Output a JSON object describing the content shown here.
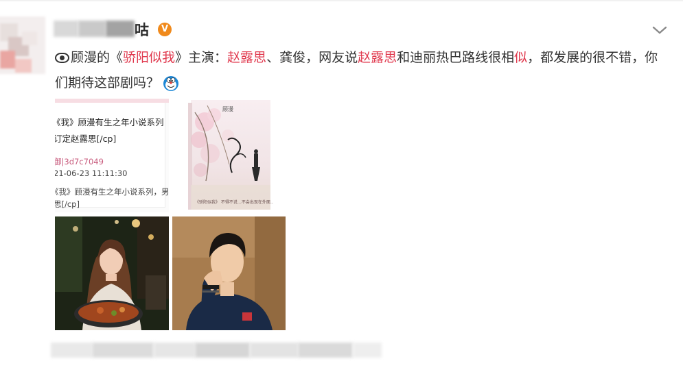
{
  "post": {
    "author_suffix": "咕",
    "verified_badge": "V",
    "menu_icon": "chevron-down-icon",
    "text": {
      "emoji_leading": "eye-emoji",
      "p1": "顾漫的《",
      "book_title": "骄阳似我",
      "p2": "》主演：",
      "actress": "赵露思",
      "p3": "、龚俊，网友说",
      "actress_repeat": "赵露思",
      "p4": "和迪丽热巴路线很相",
      "keyword": "似",
      "p5": "，都发展的很不错，你们期待这部剧吗？",
      "emoji_trailing": "doraemon-emoji"
    }
  },
  "images": {
    "screenshot": {
      "line1": "《我》顾漫有生之年小说系列",
      "line2": "订定赵露思[/cp]",
      "line3": "御|3d7c7049",
      "line4": "21-06-23 11:11:30",
      "line5": "《我》顾漫有生之年小说系列，男主",
      "line6": "思[/cp]"
    },
    "book_cover": {
      "author": "顾漫",
      "title_script": "骄阳似我",
      "tagline": "《骄阳似我》 不得不说…不会出现在外面…"
    },
    "photo_woman": "woman-restaurant-photo",
    "photo_man": "man-portrait-photo"
  },
  "colors": {
    "highlight": "#e0374c",
    "text": "#333333",
    "verified": "#f08a1c"
  }
}
